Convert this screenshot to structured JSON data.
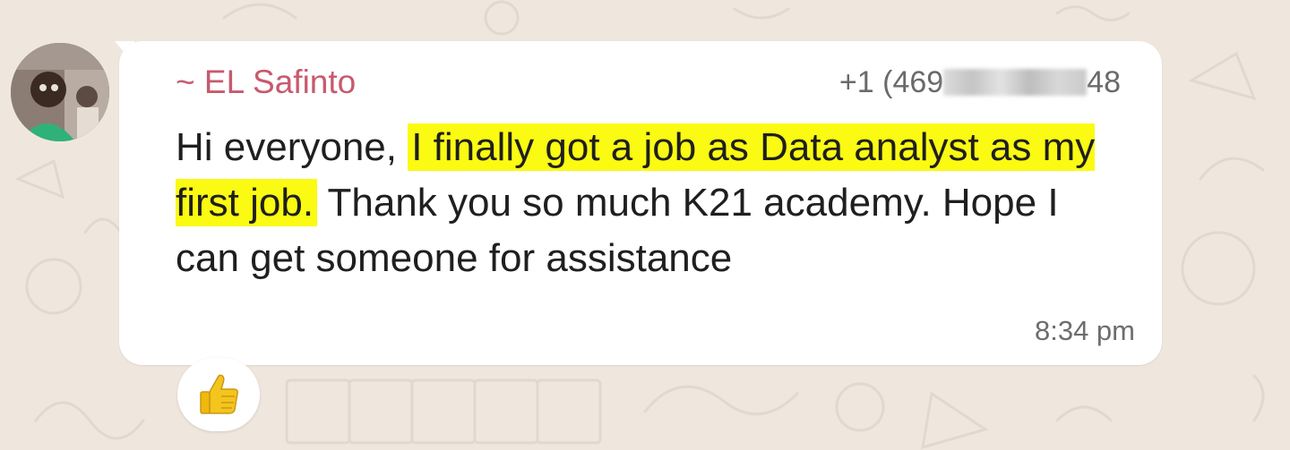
{
  "message": {
    "sender_name": "~ EL Safinto",
    "sender_phone_prefix": "+1 (469",
    "sender_phone_suffix": "48",
    "text_before": "Hi everyone, ",
    "text_highlighted": "I finally got a job as Data analyst as my first job.",
    "text_after": " Thank you so much K21 academy. Hope I can get someone for assistance",
    "timestamp": "8:34 pm"
  },
  "reaction": {
    "emoji_icon": "thumbs-up-icon"
  },
  "colors": {
    "sender_name": "#c75a6e",
    "highlight": "#fbfa13",
    "bubble": "#ffffff",
    "wallpaper": "#efe7de"
  }
}
